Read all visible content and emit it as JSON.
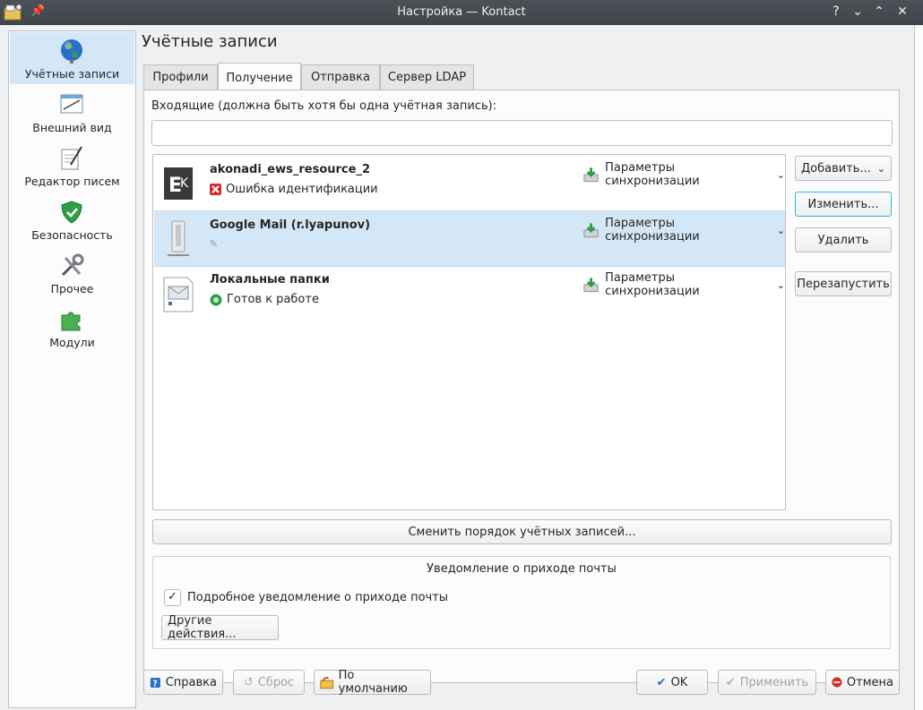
{
  "window": {
    "title": "Настройка — Kontact",
    "help_btn": "?",
    "min_btn": "⌄",
    "max_btn": "⌃",
    "close_btn": "✕"
  },
  "sidebar": {
    "items": [
      {
        "label": "Учётные записи",
        "icon": "globe-icon"
      },
      {
        "label": "Внешний вид",
        "icon": "appearance-icon"
      },
      {
        "label": "Редактор писем",
        "icon": "composer-icon"
      },
      {
        "label": "Безопасность",
        "icon": "shield-icon"
      },
      {
        "label": "Прочее",
        "icon": "tools-icon"
      },
      {
        "label": "Модули",
        "icon": "puzzle-icon"
      }
    ]
  },
  "page": {
    "title": "Учётные записи",
    "tabs": [
      "Профили",
      "Получение",
      "Отправка",
      "Сервер LDAP"
    ],
    "active_tab": "Получение",
    "incoming_label": "Входящие (должна быть хотя бы одна учётная запись):",
    "filter_value": ""
  },
  "accounts": [
    {
      "name": "akonadi_ews_resource_2",
      "status": "Ошибка идентификации",
      "status_type": "error",
      "sync_label": "Параметры синхронизации"
    },
    {
      "name": "Google Mail (r.lyapunov)",
      "status": "",
      "status_type": "busy",
      "sync_label": "Параметры синхронизации"
    },
    {
      "name": "Локальные папки",
      "status": "Готов к работе",
      "status_type": "ready",
      "sync_label": "Параметры синхронизации"
    }
  ],
  "account_buttons": {
    "add": "Добавить...",
    "modify": "Изменить...",
    "remove": "Удалить",
    "restart": "Перезапустить"
  },
  "reorder_button": "Сменить порядок учётных записей...",
  "notification": {
    "title": "Уведомление о приходе почты",
    "checkbox_label": "Подробное уведомление о приходе почты",
    "checked": true,
    "other_actions": "Другие действия..."
  },
  "footer": {
    "help": "Справка",
    "reset": "Сброс",
    "defaults": "По умолчанию",
    "ok": "OK",
    "apply": "Применить",
    "cancel": "Отмена"
  },
  "colors": {
    "selection": "#d4e7f6",
    "focus": "#3daee9",
    "titlebar": "#475057"
  }
}
